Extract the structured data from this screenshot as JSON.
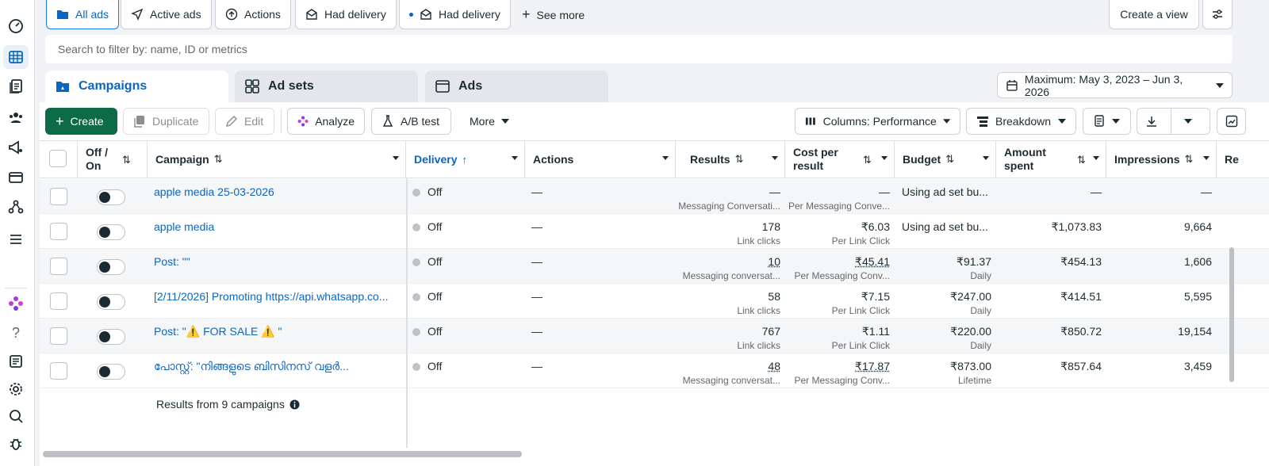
{
  "rail": {
    "icons": [
      "dashboard-icon",
      "table-icon",
      "documents-icon",
      "audience-icon",
      "campaign-settings-icon",
      "billing-icon",
      "connections-icon",
      "menu-icon",
      "ai-icon",
      "help-icon",
      "news-icon",
      "settings-icon",
      "search-icon",
      "bug-icon"
    ]
  },
  "filters": {
    "items": [
      {
        "label": "All ads",
        "icon": "folder-icon"
      },
      {
        "label": "Active ads",
        "icon": "send-icon"
      },
      {
        "label": "Actions",
        "icon": "upload-circle-icon"
      },
      {
        "label": "Had delivery",
        "icon": "envelope-icon"
      },
      {
        "label": "Had delivery",
        "icon": "envelope-icon"
      }
    ],
    "see_more": "See more",
    "create_view": "Create a view"
  },
  "search": {
    "placeholder": "Search to filter by: name, ID or metrics"
  },
  "tabs": [
    "Campaigns",
    "Ad sets",
    "Ads"
  ],
  "date_range": "Maximum: May 3, 2023 – Jun 3, 2026",
  "toolbar": {
    "create": "Create",
    "duplicate": "Duplicate",
    "edit": "Edit",
    "analyze": "Analyze",
    "ab_test": "A/B test",
    "more": "More",
    "columns": "Columns: Performance",
    "breakdown": "Breakdown"
  },
  "table": {
    "headers": {
      "off_on": "Off / On",
      "campaign": "Campaign",
      "delivery": "Delivery",
      "actions": "Actions",
      "results": "Results",
      "cost_per_result": "Cost per result",
      "budget": "Budget",
      "amount_spent": "Amount spent",
      "impressions": "Impressions",
      "reach": "Re"
    },
    "rows": [
      {
        "campaign": "apple media 25-03-2026",
        "delivery": "Off",
        "actions": "—",
        "results": "—",
        "results_sub": "Messaging Conversati...",
        "cost": "—",
        "cost_sub": "Per Messaging Conve...",
        "budget": "Using ad set bu...",
        "budget_sub": "",
        "spent": "—",
        "impressions": "—"
      },
      {
        "campaign": "apple media",
        "delivery": "Off",
        "actions": "—",
        "results": "178",
        "results_sub": "Link clicks",
        "cost": "₹6.03",
        "cost_sub": "Per Link Click",
        "budget": "Using ad set bu...",
        "budget_sub": "",
        "spent": "₹1,073.83",
        "impressions": "9,664"
      },
      {
        "campaign": "Post: \"\"",
        "delivery": "Off",
        "actions": "—",
        "results": "10",
        "results_sub": "Messaging conversat...",
        "cost": "₹45.41",
        "cost_sub": "Per Messaging Conv...",
        "budget": "₹91.37",
        "budget_sub": "Daily",
        "spent": "₹454.13",
        "impressions": "1,606"
      },
      {
        "campaign": "[2/11/2026] Promoting https://api.whatsapp.co...",
        "delivery": "Off",
        "actions": "—",
        "results": "58",
        "results_sub": "Link clicks",
        "cost": "₹7.15",
        "cost_sub": "Per Link Click",
        "budget": "₹247.00",
        "budget_sub": "Daily",
        "spent": "₹414.51",
        "impressions": "5,595"
      },
      {
        "campaign": "Post: \"⚠️ FOR SALE ⚠️ \"",
        "delivery": "Off",
        "actions": "—",
        "results": "767",
        "results_sub": "Link clicks",
        "cost": "₹1.11",
        "cost_sub": "Per Link Click",
        "budget": "₹220.00",
        "budget_sub": "Daily",
        "spent": "₹850.72",
        "impressions": "19,154"
      },
      {
        "campaign": "പോസ്റ്റ്: \"നിങ്ങളുടെ ബിസിനസ് വളർ...",
        "delivery": "Off",
        "actions": "—",
        "results": "48",
        "results_sub": "Messaging conversat...",
        "cost": "₹17.87",
        "cost_sub": "Per Messaging Conv...",
        "budget": "₹873.00",
        "budget_sub": "Lifetime",
        "spent": "₹857.64",
        "impressions": "3,459"
      }
    ],
    "footer": "Results from 9 campaigns"
  }
}
